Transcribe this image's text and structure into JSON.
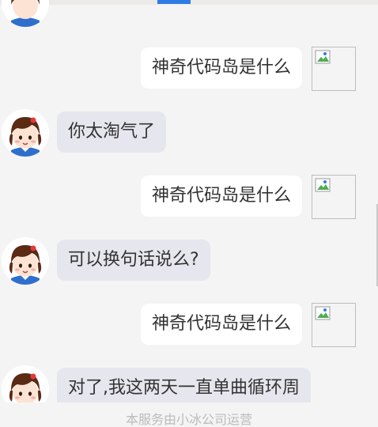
{
  "colors": {
    "page_background": "#f4f4f4",
    "bot_bubble": "#e6e6ee",
    "user_bubble": "#ffffff",
    "accent": "#2f7be6",
    "footer_text": "#bbbbbb"
  },
  "messages": [
    {
      "sender": "user",
      "text": "神奇代码岛是什么"
    },
    {
      "sender": "bot",
      "text": "你太淘气了"
    },
    {
      "sender": "user",
      "text": "神奇代码岛是什么"
    },
    {
      "sender": "bot",
      "text": "可以换句话说么?"
    },
    {
      "sender": "user",
      "text": "神奇代码岛是什么"
    },
    {
      "sender": "bot",
      "text": "对了,我这两天一直单曲循环周"
    }
  ],
  "footer": {
    "text": "本服务由小冰公司运营"
  }
}
